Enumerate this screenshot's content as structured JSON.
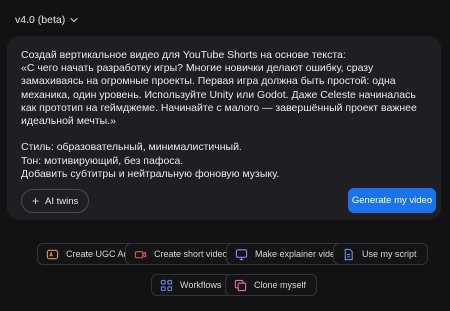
{
  "version": {
    "label": "v4.0 (beta)"
  },
  "prompt": {
    "text": "Создай вертикальное видео для YouTube Shorts на основе текста:\n«С чего начать разработку игры? Многие новички делают ошибку, сразу замахиваясь на огромные проекты. Первая игра должна быть простой: одна механика, один уровень. Используйте Unity или Godot. Даже Celeste начиналась как прототип на геймджеме. Начинайте с малого — завершённый проект важнее идеальной мечты.»\n\nСтиль: образовательный, минималистичный.\nТон: мотивирующий, без пафоса.\nДобавить субтитры и нейтральную фоновую музыку."
  },
  "actions": {
    "ai_twins_label": "AI twins",
    "generate_label": "Generate my video"
  },
  "quick_actions": [
    {
      "label": "Create UGC Ad",
      "icon": "ugc-ad-icon"
    },
    {
      "label": "Create short video",
      "icon": "video-camera-icon"
    },
    {
      "label": "Make explainer video",
      "icon": "explainer-icon"
    },
    {
      "label": "Use my script",
      "icon": "script-icon"
    },
    {
      "label": "Workflows",
      "icon": "workflows-icon"
    },
    {
      "label": "Clone myself",
      "icon": "clone-icon"
    }
  ],
  "colors": {
    "background": "#121214",
    "card": "#1f1f23",
    "accent": "#1a73e8",
    "icon_orange": "#e8914a",
    "icon_red": "#e2575a",
    "icon_purple": "#9b7de8",
    "icon_blue": "#6b8cf0",
    "icon_pink": "#e86aa8"
  }
}
